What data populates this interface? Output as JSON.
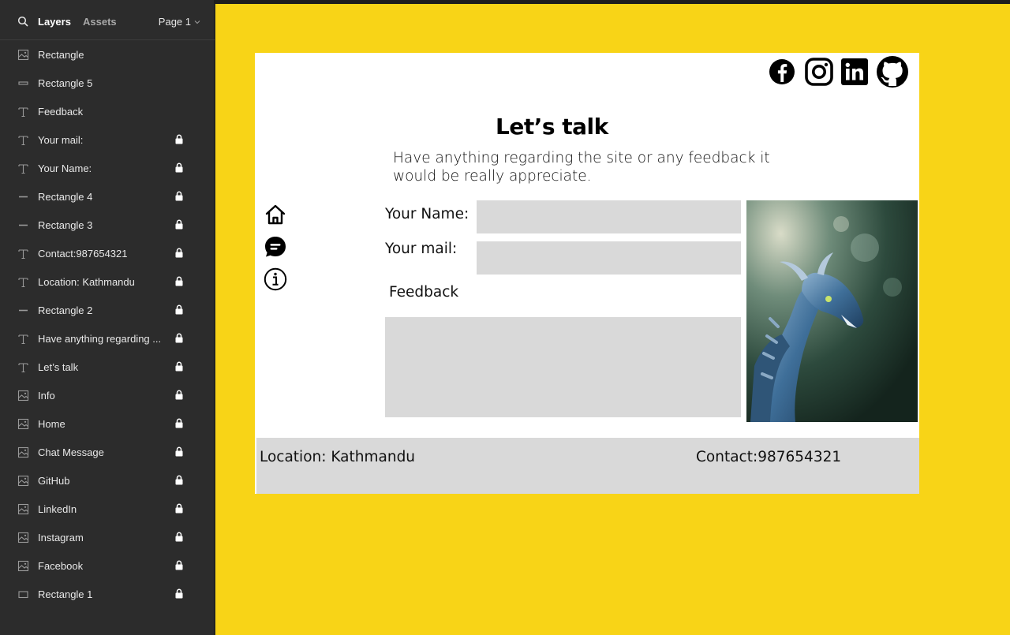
{
  "panel": {
    "tabs": {
      "layers": "Layers",
      "assets": "Assets"
    },
    "page_selector": "Page 1",
    "layers": [
      {
        "name": "Rectangle",
        "icon": "image-icon",
        "locked": false
      },
      {
        "name": "Rectangle 5",
        "icon": "rectangle-thin-icon",
        "locked": false
      },
      {
        "name": "Feedback",
        "icon": "text-icon",
        "locked": false
      },
      {
        "name": "Your mail:",
        "icon": "text-icon",
        "locked": true
      },
      {
        "name": "Your Name:",
        "icon": "text-icon",
        "locked": true
      },
      {
        "name": "Rectangle 4",
        "icon": "line-icon",
        "locked": true
      },
      {
        "name": "Rectangle 3",
        "icon": "line-icon",
        "locked": true
      },
      {
        "name": "Contact:987654321",
        "icon": "text-icon",
        "locked": true
      },
      {
        "name": "Location: Kathmandu",
        "icon": "text-icon",
        "locked": true
      },
      {
        "name": "Rectangle 2",
        "icon": "line-icon",
        "locked": true
      },
      {
        "name": "Have anything regarding ...",
        "icon": "text-icon",
        "locked": true
      },
      {
        "name": "Let’s talk",
        "icon": "text-icon",
        "locked": true
      },
      {
        "name": "Info",
        "icon": "image-icon",
        "locked": true
      },
      {
        "name": "Home",
        "icon": "image-icon",
        "locked": true
      },
      {
        "name": "Chat Message",
        "icon": "image-icon",
        "locked": true
      },
      {
        "name": "GitHub",
        "icon": "image-icon",
        "locked": true
      },
      {
        "name": "LinkedIn",
        "icon": "image-icon",
        "locked": true
      },
      {
        "name": "Instagram",
        "icon": "image-icon",
        "locked": true
      },
      {
        "name": "Facebook",
        "icon": "image-icon",
        "locked": true
      },
      {
        "name": "Rectangle 1",
        "icon": "rectangle-icon",
        "locked": true
      }
    ]
  },
  "design": {
    "title": "Let’s talk",
    "subtitle": "Have anything regarding the site or any feedback it would be really appreciate.",
    "labels": {
      "name": "Your Name:",
      "mail": "Your mail:",
      "feedback": "Feedback"
    },
    "footer": {
      "location": "Location: Kathmandu",
      "contact": "Contact:987654321"
    }
  },
  "colors": {
    "canvas": "#f8d417",
    "panel": "#2c2c2c",
    "field": "#d9d9d9",
    "accent": "#0d99ff"
  }
}
